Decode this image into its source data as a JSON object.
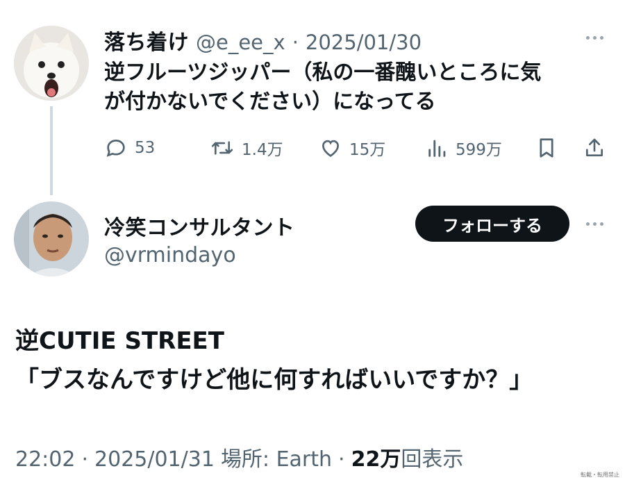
{
  "parent": {
    "display_name": "落ち着け",
    "handle": "@e_ee_x",
    "sep": "·",
    "date": "2025/01/30",
    "text_line1": "逆フルーツジッパー（私の一番醜いところに気",
    "text_line2": "が付かないでください）になってる",
    "stats": {
      "replies": "53",
      "reposts": "1.4万",
      "likes": "15万",
      "views": "599万"
    }
  },
  "reply": {
    "display_name": "冷笑コンサルタント",
    "handle": "@vrmindayo",
    "follow_label": "フォローする",
    "text_line1": "逆CUTIE STREET",
    "text_line2": "「ブスなんですけど他に何すればいいですか？」",
    "meta": {
      "time": "22:02",
      "sep1": "·",
      "date": "2025/01/31",
      "location": "場所: Earth",
      "sep2": "·",
      "views_count": "22万",
      "views_label": "回表示"
    }
  },
  "watermark": "転載・転用禁止",
  "colors": {
    "text": "#0f1419",
    "secondary": "#536471",
    "thread_line": "#cfd9de",
    "follow_bg": "#0f1419"
  },
  "icons": [
    "reply-icon",
    "repost-icon",
    "like-icon",
    "views-icon",
    "bookmark-icon",
    "share-icon",
    "more-icon"
  ]
}
